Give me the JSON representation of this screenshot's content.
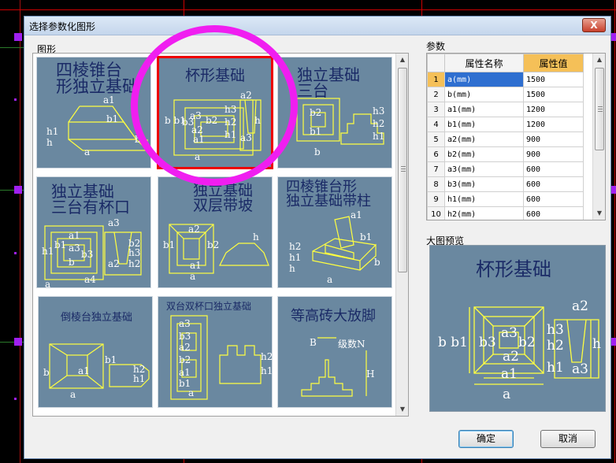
{
  "dialog": {
    "title": "选择参数化图形",
    "close_label": "X",
    "gallery_label": "图形",
    "params_label": "参数",
    "preview_label": "大图预览",
    "ok_label": "确定",
    "cancel_label": "取消"
  },
  "tiles": [
    {
      "title": "四棱锥台\n形独立基础",
      "labels": [
        "a1",
        "b1",
        "h1",
        "h",
        "a",
        "b"
      ]
    },
    {
      "title": "杯形基础",
      "labels": [
        "a2",
        "a3",
        "h3",
        "h2",
        "b b1",
        "b3",
        "b2",
        "a2",
        "h",
        "h1",
        "a1",
        "a3",
        "a"
      ]
    },
    {
      "title": "独立基础\n三台",
      "labels": [
        "b2",
        "b1",
        "h3",
        "h2",
        "h1",
        "b"
      ]
    },
    {
      "title": "独立基础\n三台有杯口",
      "labels": [
        "a3",
        "a1",
        "b1",
        "a3",
        "b3",
        "b2",
        "h3",
        "h2",
        "h1",
        "b",
        "a2",
        "a4",
        "a"
      ]
    },
    {
      "title": "独立基础\n双层带坡",
      "labels": [
        "a2",
        "b1",
        "b2",
        "h",
        "a1",
        "a"
      ]
    },
    {
      "title": "四棱锥台形\n独立基础带柱",
      "labels": [
        "a1",
        "b1",
        "h2",
        "h1",
        "h",
        "b",
        "a"
      ]
    },
    {
      "title": "倒棱台独立基础",
      "labels": [
        "b1",
        "a1",
        "b",
        "h2",
        "h1",
        "a"
      ]
    },
    {
      "title": "双台双杯口独立基础",
      "labels": [
        "a3",
        "b3",
        "a2",
        "b2",
        "a1",
        "b1",
        "h2",
        "h1",
        "a"
      ]
    },
    {
      "title": "等高砖大放脚",
      "labels": [
        "B",
        "级数N",
        "H"
      ]
    }
  ],
  "param_table": {
    "headers": [
      "",
      "属性名称",
      "属性值"
    ],
    "rows": [
      {
        "idx": "1",
        "name": "a(mm)",
        "value": "1500"
      },
      {
        "idx": "2",
        "name": "b(mm)",
        "value": "1500"
      },
      {
        "idx": "3",
        "name": "a1(mm)",
        "value": "1200"
      },
      {
        "idx": "4",
        "name": "b1(mm)",
        "value": "1200"
      },
      {
        "idx": "5",
        "name": "a2(mm)",
        "value": "900"
      },
      {
        "idx": "6",
        "name": "b2(mm)",
        "value": "900"
      },
      {
        "idx": "7",
        "name": "a3(mm)",
        "value": "600"
      },
      {
        "idx": "8",
        "name": "b3(mm)",
        "value": "600"
      },
      {
        "idx": "9",
        "name": "h1(mm)",
        "value": "600"
      },
      {
        "idx": "10",
        "name": "h2(mm)",
        "value": "600"
      }
    ]
  },
  "preview": {
    "title": "杯形基础",
    "labels": [
      "a2",
      "a3",
      "h3",
      "h2",
      "b b1",
      "b3",
      "b2",
      "a2",
      "h",
      "h1",
      "a1",
      "a3",
      "a"
    ]
  },
  "colors": {
    "tile_bg": "#6a88a0",
    "drawing": "#ffff40",
    "title_text": "#1a2a66",
    "selected_border": "#ee0000",
    "ring": "#f01ef0",
    "header_accent": "#f5c058",
    "row_select": "#2f6fd0"
  }
}
